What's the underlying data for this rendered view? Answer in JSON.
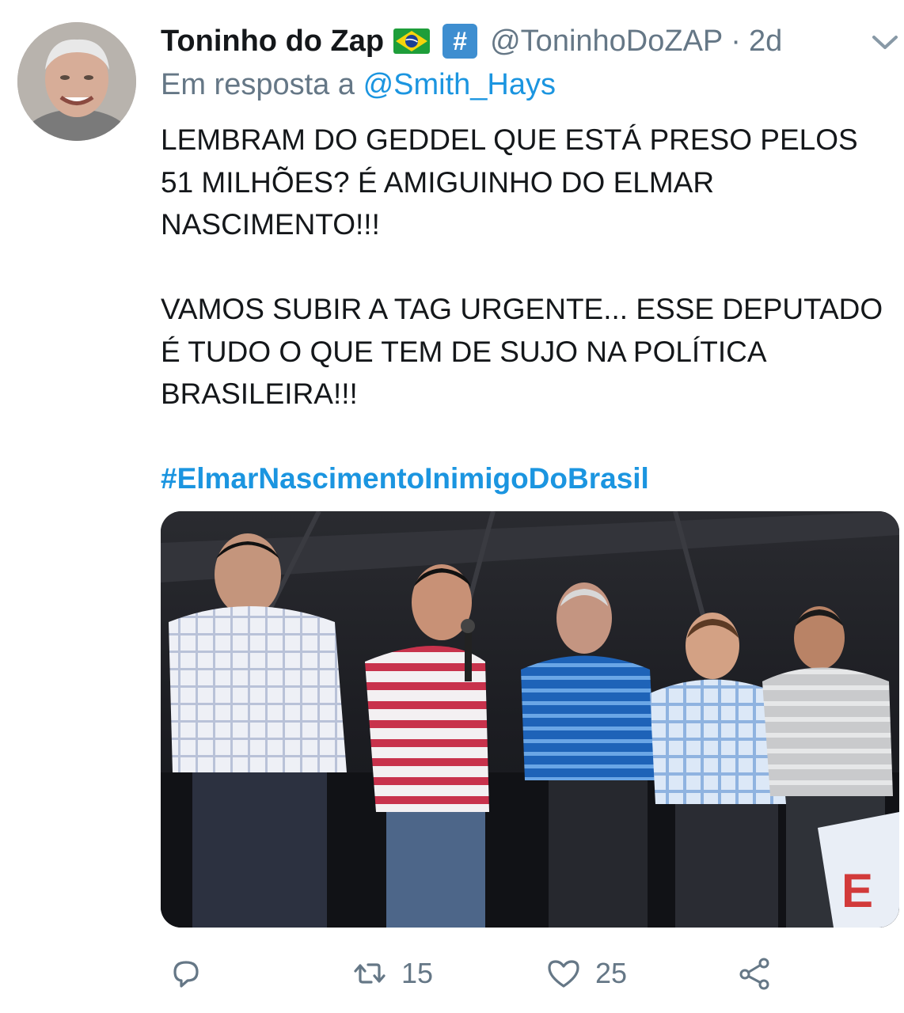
{
  "tweet": {
    "author_name": "Toninho do Zap",
    "badge_hash": "#",
    "handle": "@ToninhoDoZAP",
    "separator": "·",
    "time": "2d",
    "reply_prefix": "Em resposta a",
    "reply_to": "@Smith_Hays",
    "paragraph1": "LEMBRAM DO GEDDEL QUE ESTÁ PRESO PELOS 51 MILHÕES? É AMIGUINHO DO ELMAR NASCIMENTO!!!",
    "paragraph2": "VAMOS SUBIR A TAG URGENTE... ESSE DEPUTADO É TUDO O QUE TEM DE SUJO NA POLÍTICA BRASILEIRA!!!",
    "hashtag": "#ElmarNascimentoInimigoDoBrasil"
  },
  "actions": {
    "reply_count": "",
    "retweet_count": "15",
    "like_count": "25"
  },
  "icons": {
    "avatar": "avatar-photo",
    "flag": "brazil-flag-icon",
    "badge": "hash-badge-icon",
    "more": "chevron-down-icon",
    "reply": "reply-icon",
    "retweet": "retweet-icon",
    "like": "heart-icon",
    "share": "share-icon"
  },
  "colors": {
    "link": "#1b95e0",
    "muted": "#657786",
    "text": "#14171a",
    "badge": "#3e8ed0"
  }
}
